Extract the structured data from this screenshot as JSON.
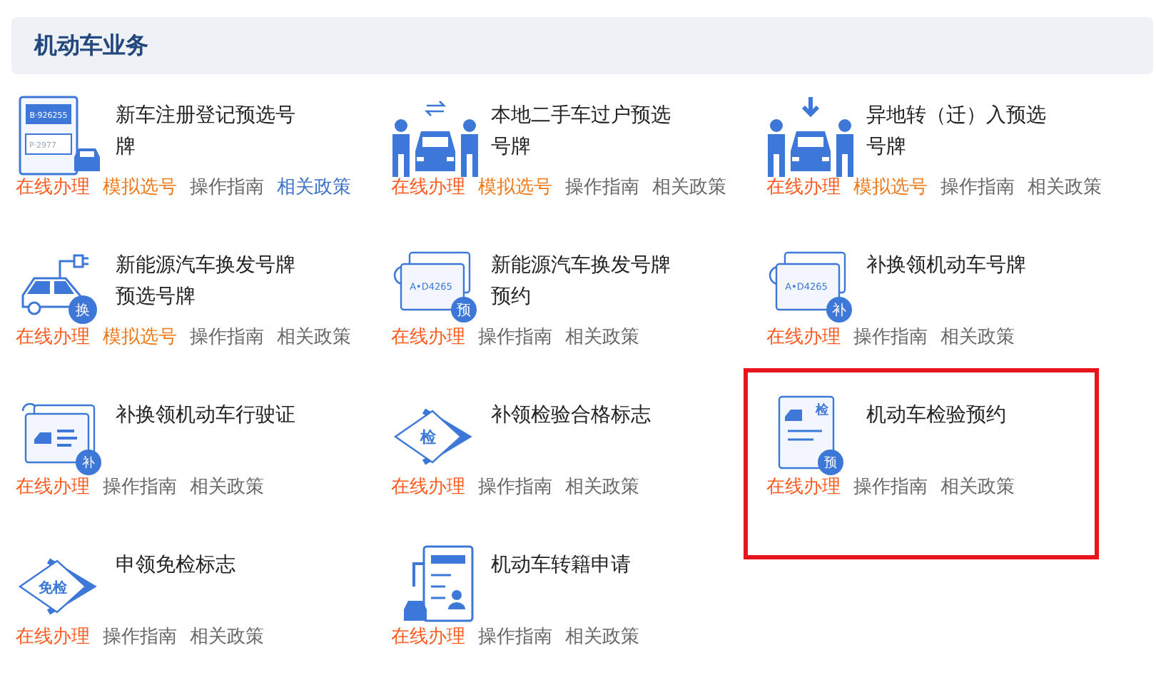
{
  "section": {
    "title": "机动车业务"
  },
  "services": [
    {
      "title": "新车注册登记预选号牌",
      "selected": false,
      "icon": {
        "kind": "plate-form",
        "plates": [
          "B·926255",
          "P·2977"
        ]
      },
      "links": [
        {
          "kind": "online",
          "label": "在线办理",
          "active": false
        },
        {
          "kind": "simulate",
          "label": "模拟选号",
          "active": false
        },
        {
          "kind": "guide",
          "label": "操作指南",
          "active": false
        },
        {
          "kind": "policy",
          "label": "相关政策",
          "active": true
        }
      ]
    },
    {
      "title": "本地二手车过户预选号牌",
      "selected": false,
      "icon": {
        "kind": "people-swap"
      },
      "links": [
        {
          "kind": "online",
          "label": "在线办理",
          "active": false
        },
        {
          "kind": "simulate",
          "label": "模拟选号",
          "active": false
        },
        {
          "kind": "guide",
          "label": "操作指南",
          "active": false
        },
        {
          "kind": "policy",
          "label": "相关政策",
          "active": false
        }
      ]
    },
    {
      "title": "异地转（迁）入预选号牌",
      "selected": false,
      "icon": {
        "kind": "people-down"
      },
      "links": [
        {
          "kind": "online",
          "label": "在线办理",
          "active": false
        },
        {
          "kind": "simulate",
          "label": "模拟选号",
          "active": false
        },
        {
          "kind": "guide",
          "label": "操作指南",
          "active": false
        },
        {
          "kind": "policy",
          "label": "相关政策",
          "active": false
        }
      ]
    },
    {
      "title": "新能源汽车换发号牌预选号牌",
      "selected": false,
      "icon": {
        "kind": "ev-car",
        "badge": "换"
      },
      "links": [
        {
          "kind": "online",
          "label": "在线办理",
          "active": false
        },
        {
          "kind": "simulate",
          "label": "模拟选号",
          "active": false
        },
        {
          "kind": "guide",
          "label": "操作指南",
          "active": false
        },
        {
          "kind": "policy",
          "label": "相关政策",
          "active": false
        }
      ]
    },
    {
      "title": "新能源汽车换发号牌预约",
      "selected": false,
      "icon": {
        "kind": "plates",
        "plates": [
          "A•D4265"
        ],
        "badge": "预"
      },
      "links": [
        {
          "kind": "online",
          "label": "在线办理",
          "active": false
        },
        {
          "kind": "guide",
          "label": "操作指南",
          "active": false
        },
        {
          "kind": "policy",
          "label": "相关政策",
          "active": false
        }
      ]
    },
    {
      "title": "补换领机动车号牌",
      "selected": false,
      "icon": {
        "kind": "plates",
        "plates": [
          "A•D4265"
        ],
        "badge": "补"
      },
      "links": [
        {
          "kind": "online",
          "label": "在线办理",
          "active": false
        },
        {
          "kind": "guide",
          "label": "操作指南",
          "active": false
        },
        {
          "kind": "policy",
          "label": "相关政策",
          "active": false
        }
      ]
    },
    {
      "title": "补换领机动车行驶证",
      "selected": false,
      "icon": {
        "kind": "license",
        "badge": "补"
      },
      "links": [
        {
          "kind": "online",
          "label": "在线办理",
          "active": false
        },
        {
          "kind": "guide",
          "label": "操作指南",
          "active": false
        },
        {
          "kind": "policy",
          "label": "相关政策",
          "active": false
        }
      ]
    },
    {
      "title": "补领检验合格标志",
      "selected": false,
      "icon": {
        "kind": "diamond",
        "badge": "检"
      },
      "links": [
        {
          "kind": "online",
          "label": "在线办理",
          "active": false
        },
        {
          "kind": "guide",
          "label": "操作指南",
          "active": false
        },
        {
          "kind": "policy",
          "label": "相关政策",
          "active": false
        }
      ]
    },
    {
      "title": "机动车检验预约",
      "selected": true,
      "icon": {
        "kind": "inspection-doc",
        "tag": "检",
        "badge": "预"
      },
      "links": [
        {
          "kind": "online",
          "label": "在线办理",
          "active": false
        },
        {
          "kind": "guide",
          "label": "操作指南",
          "active": false
        },
        {
          "kind": "policy",
          "label": "相关政策",
          "active": false
        }
      ]
    },
    {
      "title": "申领免检标志",
      "selected": false,
      "icon": {
        "kind": "diamond",
        "badge": "免检"
      },
      "links": [
        {
          "kind": "online",
          "label": "在线办理",
          "active": false
        },
        {
          "kind": "guide",
          "label": "操作指南",
          "active": false
        },
        {
          "kind": "policy",
          "label": "相关政策",
          "active": false
        }
      ]
    },
    {
      "title": "机动车转籍申请",
      "selected": false,
      "icon": {
        "kind": "archive-doc"
      },
      "links": [
        {
          "kind": "online",
          "label": "在线办理",
          "active": false
        },
        {
          "kind": "guide",
          "label": "操作指南",
          "active": false
        },
        {
          "kind": "policy",
          "label": "相关政策",
          "active": false
        }
      ]
    }
  ]
}
